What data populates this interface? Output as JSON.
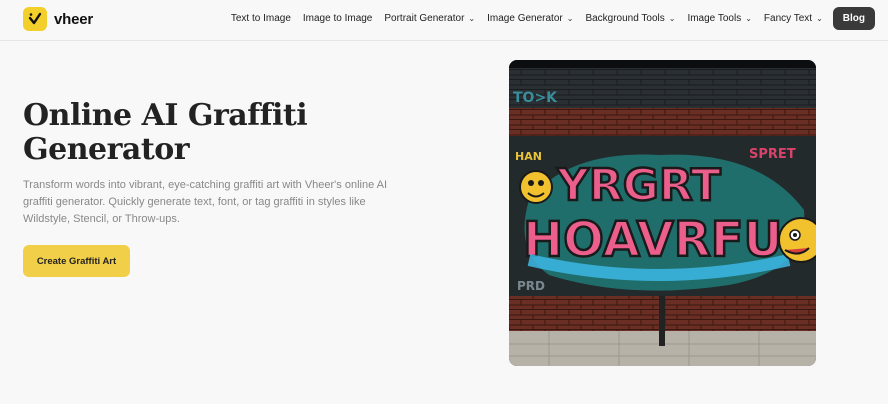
{
  "brand": {
    "name": "vheer",
    "accent": "#f2cf2a"
  },
  "nav": {
    "items": [
      {
        "label": "Text to Image",
        "has_dropdown": false
      },
      {
        "label": "Image to Image",
        "has_dropdown": false
      },
      {
        "label": "Portrait Generator",
        "has_dropdown": true
      },
      {
        "label": "Image Generator",
        "has_dropdown": true
      },
      {
        "label": "Background Tools",
        "has_dropdown": true
      },
      {
        "label": "Image Tools",
        "has_dropdown": true
      },
      {
        "label": "Fancy Text",
        "has_dropdown": true
      }
    ],
    "blog_label": "Blog"
  },
  "hero": {
    "title": "Online AI Graffiti Generator",
    "description": "Transform words into vibrant, eye-catching graffiti art with Vheer's online AI graffiti generator. Quickly generate text, font, or tag graffiti in styles like Wildstyle, Stencil, or Throw-ups.",
    "cta_label": "Create Graffiti Art"
  },
  "image": {
    "icon": "graffiti-wall-image",
    "text": [
      "YRGRT",
      "HOAVRFU"
    ]
  }
}
